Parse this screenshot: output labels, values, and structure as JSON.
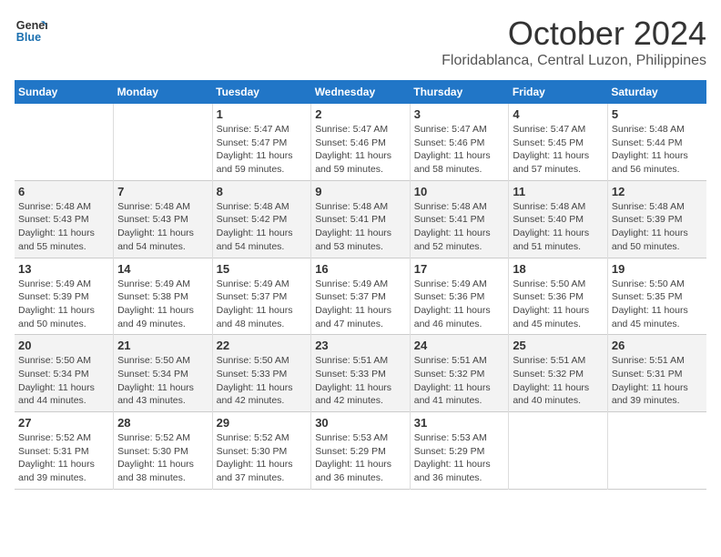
{
  "header": {
    "logo_line1": "General",
    "logo_line2": "Blue",
    "month": "October 2024",
    "location": "Floridablanca, Central Luzon, Philippines"
  },
  "weekdays": [
    "Sunday",
    "Monday",
    "Tuesday",
    "Wednesday",
    "Thursday",
    "Friday",
    "Saturday"
  ],
  "weeks": [
    [
      {
        "day": "",
        "sunrise": "",
        "sunset": "",
        "daylight": ""
      },
      {
        "day": "",
        "sunrise": "",
        "sunset": "",
        "daylight": ""
      },
      {
        "day": "1",
        "sunrise": "Sunrise: 5:47 AM",
        "sunset": "Sunset: 5:47 PM",
        "daylight": "Daylight: 11 hours and 59 minutes."
      },
      {
        "day": "2",
        "sunrise": "Sunrise: 5:47 AM",
        "sunset": "Sunset: 5:46 PM",
        "daylight": "Daylight: 11 hours and 59 minutes."
      },
      {
        "day": "3",
        "sunrise": "Sunrise: 5:47 AM",
        "sunset": "Sunset: 5:46 PM",
        "daylight": "Daylight: 11 hours and 58 minutes."
      },
      {
        "day": "4",
        "sunrise": "Sunrise: 5:47 AM",
        "sunset": "Sunset: 5:45 PM",
        "daylight": "Daylight: 11 hours and 57 minutes."
      },
      {
        "day": "5",
        "sunrise": "Sunrise: 5:48 AM",
        "sunset": "Sunset: 5:44 PM",
        "daylight": "Daylight: 11 hours and 56 minutes."
      }
    ],
    [
      {
        "day": "6",
        "sunrise": "Sunrise: 5:48 AM",
        "sunset": "Sunset: 5:43 PM",
        "daylight": "Daylight: 11 hours and 55 minutes."
      },
      {
        "day": "7",
        "sunrise": "Sunrise: 5:48 AM",
        "sunset": "Sunset: 5:43 PM",
        "daylight": "Daylight: 11 hours and 54 minutes."
      },
      {
        "day": "8",
        "sunrise": "Sunrise: 5:48 AM",
        "sunset": "Sunset: 5:42 PM",
        "daylight": "Daylight: 11 hours and 54 minutes."
      },
      {
        "day": "9",
        "sunrise": "Sunrise: 5:48 AM",
        "sunset": "Sunset: 5:41 PM",
        "daylight": "Daylight: 11 hours and 53 minutes."
      },
      {
        "day": "10",
        "sunrise": "Sunrise: 5:48 AM",
        "sunset": "Sunset: 5:41 PM",
        "daylight": "Daylight: 11 hours and 52 minutes."
      },
      {
        "day": "11",
        "sunrise": "Sunrise: 5:48 AM",
        "sunset": "Sunset: 5:40 PM",
        "daylight": "Daylight: 11 hours and 51 minutes."
      },
      {
        "day": "12",
        "sunrise": "Sunrise: 5:48 AM",
        "sunset": "Sunset: 5:39 PM",
        "daylight": "Daylight: 11 hours and 50 minutes."
      }
    ],
    [
      {
        "day": "13",
        "sunrise": "Sunrise: 5:49 AM",
        "sunset": "Sunset: 5:39 PM",
        "daylight": "Daylight: 11 hours and 50 minutes."
      },
      {
        "day": "14",
        "sunrise": "Sunrise: 5:49 AM",
        "sunset": "Sunset: 5:38 PM",
        "daylight": "Daylight: 11 hours and 49 minutes."
      },
      {
        "day": "15",
        "sunrise": "Sunrise: 5:49 AM",
        "sunset": "Sunset: 5:37 PM",
        "daylight": "Daylight: 11 hours and 48 minutes."
      },
      {
        "day": "16",
        "sunrise": "Sunrise: 5:49 AM",
        "sunset": "Sunset: 5:37 PM",
        "daylight": "Daylight: 11 hours and 47 minutes."
      },
      {
        "day": "17",
        "sunrise": "Sunrise: 5:49 AM",
        "sunset": "Sunset: 5:36 PM",
        "daylight": "Daylight: 11 hours and 46 minutes."
      },
      {
        "day": "18",
        "sunrise": "Sunrise: 5:50 AM",
        "sunset": "Sunset: 5:36 PM",
        "daylight": "Daylight: 11 hours and 45 minutes."
      },
      {
        "day": "19",
        "sunrise": "Sunrise: 5:50 AM",
        "sunset": "Sunset: 5:35 PM",
        "daylight": "Daylight: 11 hours and 45 minutes."
      }
    ],
    [
      {
        "day": "20",
        "sunrise": "Sunrise: 5:50 AM",
        "sunset": "Sunset: 5:34 PM",
        "daylight": "Daylight: 11 hours and 44 minutes."
      },
      {
        "day": "21",
        "sunrise": "Sunrise: 5:50 AM",
        "sunset": "Sunset: 5:34 PM",
        "daylight": "Daylight: 11 hours and 43 minutes."
      },
      {
        "day": "22",
        "sunrise": "Sunrise: 5:50 AM",
        "sunset": "Sunset: 5:33 PM",
        "daylight": "Daylight: 11 hours and 42 minutes."
      },
      {
        "day": "23",
        "sunrise": "Sunrise: 5:51 AM",
        "sunset": "Sunset: 5:33 PM",
        "daylight": "Daylight: 11 hours and 42 minutes."
      },
      {
        "day": "24",
        "sunrise": "Sunrise: 5:51 AM",
        "sunset": "Sunset: 5:32 PM",
        "daylight": "Daylight: 11 hours and 41 minutes."
      },
      {
        "day": "25",
        "sunrise": "Sunrise: 5:51 AM",
        "sunset": "Sunset: 5:32 PM",
        "daylight": "Daylight: 11 hours and 40 minutes."
      },
      {
        "day": "26",
        "sunrise": "Sunrise: 5:51 AM",
        "sunset": "Sunset: 5:31 PM",
        "daylight": "Daylight: 11 hours and 39 minutes."
      }
    ],
    [
      {
        "day": "27",
        "sunrise": "Sunrise: 5:52 AM",
        "sunset": "Sunset: 5:31 PM",
        "daylight": "Daylight: 11 hours and 39 minutes."
      },
      {
        "day": "28",
        "sunrise": "Sunrise: 5:52 AM",
        "sunset": "Sunset: 5:30 PM",
        "daylight": "Daylight: 11 hours and 38 minutes."
      },
      {
        "day": "29",
        "sunrise": "Sunrise: 5:52 AM",
        "sunset": "Sunset: 5:30 PM",
        "daylight": "Daylight: 11 hours and 37 minutes."
      },
      {
        "day": "30",
        "sunrise": "Sunrise: 5:53 AM",
        "sunset": "Sunset: 5:29 PM",
        "daylight": "Daylight: 11 hours and 36 minutes."
      },
      {
        "day": "31",
        "sunrise": "Sunrise: 5:53 AM",
        "sunset": "Sunset: 5:29 PM",
        "daylight": "Daylight: 11 hours and 36 minutes."
      },
      {
        "day": "",
        "sunrise": "",
        "sunset": "",
        "daylight": ""
      },
      {
        "day": "",
        "sunrise": "",
        "sunset": "",
        "daylight": ""
      }
    ]
  ]
}
